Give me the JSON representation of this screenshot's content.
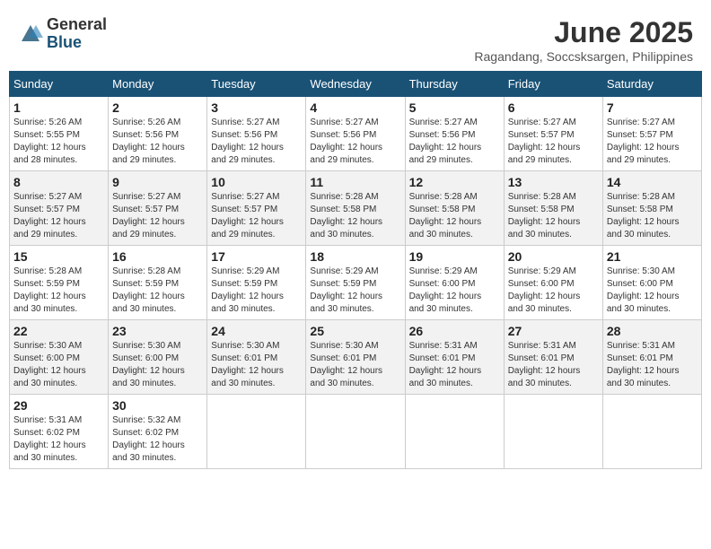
{
  "logo": {
    "general": "General",
    "blue": "Blue"
  },
  "title": {
    "month": "June 2025",
    "location": "Ragandang, Soccsksargen, Philippines"
  },
  "headers": [
    "Sunday",
    "Monday",
    "Tuesday",
    "Wednesday",
    "Thursday",
    "Friday",
    "Saturday"
  ],
  "weeks": [
    [
      {
        "day": "1",
        "info": "Sunrise: 5:26 AM\nSunset: 5:55 PM\nDaylight: 12 hours\nand 28 minutes."
      },
      {
        "day": "2",
        "info": "Sunrise: 5:26 AM\nSunset: 5:56 PM\nDaylight: 12 hours\nand 29 minutes."
      },
      {
        "day": "3",
        "info": "Sunrise: 5:27 AM\nSunset: 5:56 PM\nDaylight: 12 hours\nand 29 minutes."
      },
      {
        "day": "4",
        "info": "Sunrise: 5:27 AM\nSunset: 5:56 PM\nDaylight: 12 hours\nand 29 minutes."
      },
      {
        "day": "5",
        "info": "Sunrise: 5:27 AM\nSunset: 5:56 PM\nDaylight: 12 hours\nand 29 minutes."
      },
      {
        "day": "6",
        "info": "Sunrise: 5:27 AM\nSunset: 5:57 PM\nDaylight: 12 hours\nand 29 minutes."
      },
      {
        "day": "7",
        "info": "Sunrise: 5:27 AM\nSunset: 5:57 PM\nDaylight: 12 hours\nand 29 minutes."
      }
    ],
    [
      {
        "day": "8",
        "info": "Sunrise: 5:27 AM\nSunset: 5:57 PM\nDaylight: 12 hours\nand 29 minutes."
      },
      {
        "day": "9",
        "info": "Sunrise: 5:27 AM\nSunset: 5:57 PM\nDaylight: 12 hours\nand 29 minutes."
      },
      {
        "day": "10",
        "info": "Sunrise: 5:27 AM\nSunset: 5:57 PM\nDaylight: 12 hours\nand 29 minutes."
      },
      {
        "day": "11",
        "info": "Sunrise: 5:28 AM\nSunset: 5:58 PM\nDaylight: 12 hours\nand 30 minutes."
      },
      {
        "day": "12",
        "info": "Sunrise: 5:28 AM\nSunset: 5:58 PM\nDaylight: 12 hours\nand 30 minutes."
      },
      {
        "day": "13",
        "info": "Sunrise: 5:28 AM\nSunset: 5:58 PM\nDaylight: 12 hours\nand 30 minutes."
      },
      {
        "day": "14",
        "info": "Sunrise: 5:28 AM\nSunset: 5:58 PM\nDaylight: 12 hours\nand 30 minutes."
      }
    ],
    [
      {
        "day": "15",
        "info": "Sunrise: 5:28 AM\nSunset: 5:59 PM\nDaylight: 12 hours\nand 30 minutes."
      },
      {
        "day": "16",
        "info": "Sunrise: 5:28 AM\nSunset: 5:59 PM\nDaylight: 12 hours\nand 30 minutes."
      },
      {
        "day": "17",
        "info": "Sunrise: 5:29 AM\nSunset: 5:59 PM\nDaylight: 12 hours\nand 30 minutes."
      },
      {
        "day": "18",
        "info": "Sunrise: 5:29 AM\nSunset: 5:59 PM\nDaylight: 12 hours\nand 30 minutes."
      },
      {
        "day": "19",
        "info": "Sunrise: 5:29 AM\nSunset: 6:00 PM\nDaylight: 12 hours\nand 30 minutes."
      },
      {
        "day": "20",
        "info": "Sunrise: 5:29 AM\nSunset: 6:00 PM\nDaylight: 12 hours\nand 30 minutes."
      },
      {
        "day": "21",
        "info": "Sunrise: 5:30 AM\nSunset: 6:00 PM\nDaylight: 12 hours\nand 30 minutes."
      }
    ],
    [
      {
        "day": "22",
        "info": "Sunrise: 5:30 AM\nSunset: 6:00 PM\nDaylight: 12 hours\nand 30 minutes."
      },
      {
        "day": "23",
        "info": "Sunrise: 5:30 AM\nSunset: 6:00 PM\nDaylight: 12 hours\nand 30 minutes."
      },
      {
        "day": "24",
        "info": "Sunrise: 5:30 AM\nSunset: 6:01 PM\nDaylight: 12 hours\nand 30 minutes."
      },
      {
        "day": "25",
        "info": "Sunrise: 5:30 AM\nSunset: 6:01 PM\nDaylight: 12 hours\nand 30 minutes."
      },
      {
        "day": "26",
        "info": "Sunrise: 5:31 AM\nSunset: 6:01 PM\nDaylight: 12 hours\nand 30 minutes."
      },
      {
        "day": "27",
        "info": "Sunrise: 5:31 AM\nSunset: 6:01 PM\nDaylight: 12 hours\nand 30 minutes."
      },
      {
        "day": "28",
        "info": "Sunrise: 5:31 AM\nSunset: 6:01 PM\nDaylight: 12 hours\nand 30 minutes."
      }
    ],
    [
      {
        "day": "29",
        "info": "Sunrise: 5:31 AM\nSunset: 6:02 PM\nDaylight: 12 hours\nand 30 minutes."
      },
      {
        "day": "30",
        "info": "Sunrise: 5:32 AM\nSunset: 6:02 PM\nDaylight: 12 hours\nand 30 minutes."
      },
      {
        "day": "",
        "info": ""
      },
      {
        "day": "",
        "info": ""
      },
      {
        "day": "",
        "info": ""
      },
      {
        "day": "",
        "info": ""
      },
      {
        "day": "",
        "info": ""
      }
    ]
  ]
}
